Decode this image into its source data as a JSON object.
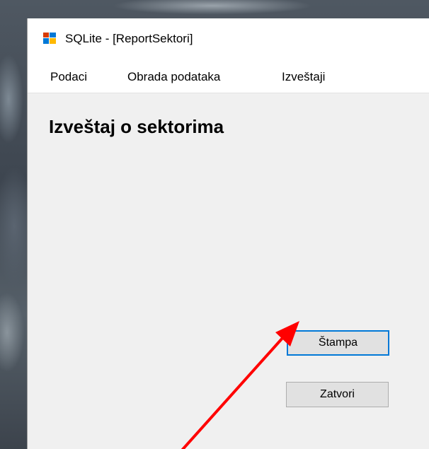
{
  "window": {
    "title": "SQLite - [ReportSektori]"
  },
  "menu": {
    "items": [
      {
        "label": "Podaci"
      },
      {
        "label": "Obrada podataka"
      },
      {
        "label": "Izveštaji"
      }
    ]
  },
  "form": {
    "heading": "Izveštaj o sektorima",
    "print_button": "Štampa",
    "close_button": "Zatvori"
  },
  "annotation": {
    "arrow_color": "#ff0000"
  },
  "icons": {
    "app": "app-window-icon",
    "annotation": "red-arrow-icon"
  }
}
